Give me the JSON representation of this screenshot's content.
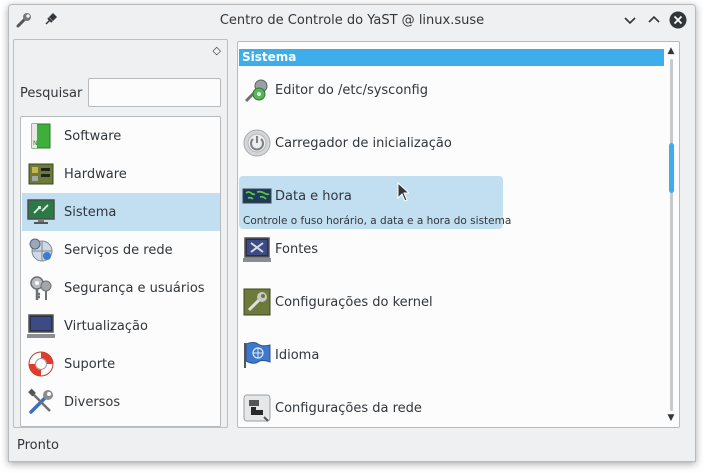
{
  "window": {
    "title": "Centro de Controle do YaST @ linux.suse",
    "accent": "#3daee9",
    "selection": "#c2dff2"
  },
  "search": {
    "label": "Pesquisar",
    "value": ""
  },
  "sidebar": {
    "items": [
      {
        "label": "Software",
        "icon": "software-icon"
      },
      {
        "label": "Hardware",
        "icon": "hardware-icon"
      },
      {
        "label": "Sistema",
        "icon": "system-icon",
        "selected": true
      },
      {
        "label": "Serviços de rede",
        "icon": "network-services-icon"
      },
      {
        "label": "Segurança e usuários",
        "icon": "keys-icon"
      },
      {
        "label": "Virtualização",
        "icon": "monitor-icon"
      },
      {
        "label": "Suporte",
        "icon": "lifebuoy-icon"
      },
      {
        "label": "Diversos",
        "icon": "tools-icon"
      }
    ]
  },
  "main": {
    "section": "Sistema",
    "modules": [
      {
        "label": "Editor do /etc/sysconfig",
        "icon": "sysconfig-editor-icon"
      },
      {
        "label": "Carregador de inicialização",
        "icon": "power-icon"
      },
      {
        "label": "Data e hora",
        "icon": "world-clock-icon",
        "description": "Controle o fuso horário, a data e a hora do sistema"
      },
      {
        "label": "Fontes",
        "icon": "fonts-icon"
      },
      {
        "label": "Configurações do kernel",
        "icon": "kernel-icon"
      },
      {
        "label": "Idioma",
        "icon": "language-flag-icon"
      },
      {
        "label": "Configurações da rede",
        "icon": "network-settings-icon"
      }
    ]
  },
  "status": {
    "text": "Pronto"
  }
}
